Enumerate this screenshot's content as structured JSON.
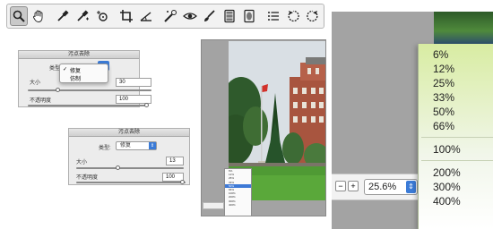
{
  "toolbar": {
    "tools": [
      {
        "icon": "zoom-icon",
        "active": true
      },
      {
        "icon": "hand-icon"
      },
      {
        "icon": "eyedropper-icon"
      },
      {
        "icon": "color-sampler-icon"
      },
      {
        "icon": "target-icon"
      },
      {
        "icon": "crop-icon"
      },
      {
        "icon": "straighten-icon"
      },
      {
        "icon": "spot-removal-icon"
      },
      {
        "icon": "red-eye-icon"
      },
      {
        "icon": "brush-icon"
      },
      {
        "icon": "graduated-filter-icon"
      },
      {
        "icon": "radial-filter-icon"
      },
      {
        "icon": "list-icon"
      },
      {
        "icon": "rotate-left-icon"
      },
      {
        "icon": "rotate-right-icon"
      }
    ]
  },
  "panel1": {
    "title": "污点去除",
    "type_label": "类型:",
    "dropdown_options": [
      "修复",
      "仿制"
    ],
    "selected_option": "修复",
    "size_label": "大小",
    "size_value": "30",
    "opacity_label": "不透明度",
    "opacity_value": "100"
  },
  "panel2": {
    "title": "污点去除",
    "type_label": "类型:",
    "type_value": "修复",
    "size_label": "大小",
    "size_value": "13",
    "opacity_label": "不透明度",
    "opacity_value": "100"
  },
  "zoom": {
    "value": "25.6%",
    "minus": "−",
    "plus": "+",
    "options": [
      "6%",
      "12%",
      "25%",
      "33%",
      "50%",
      "66%",
      "100%",
      "200%",
      "300%",
      "400%"
    ]
  }
}
